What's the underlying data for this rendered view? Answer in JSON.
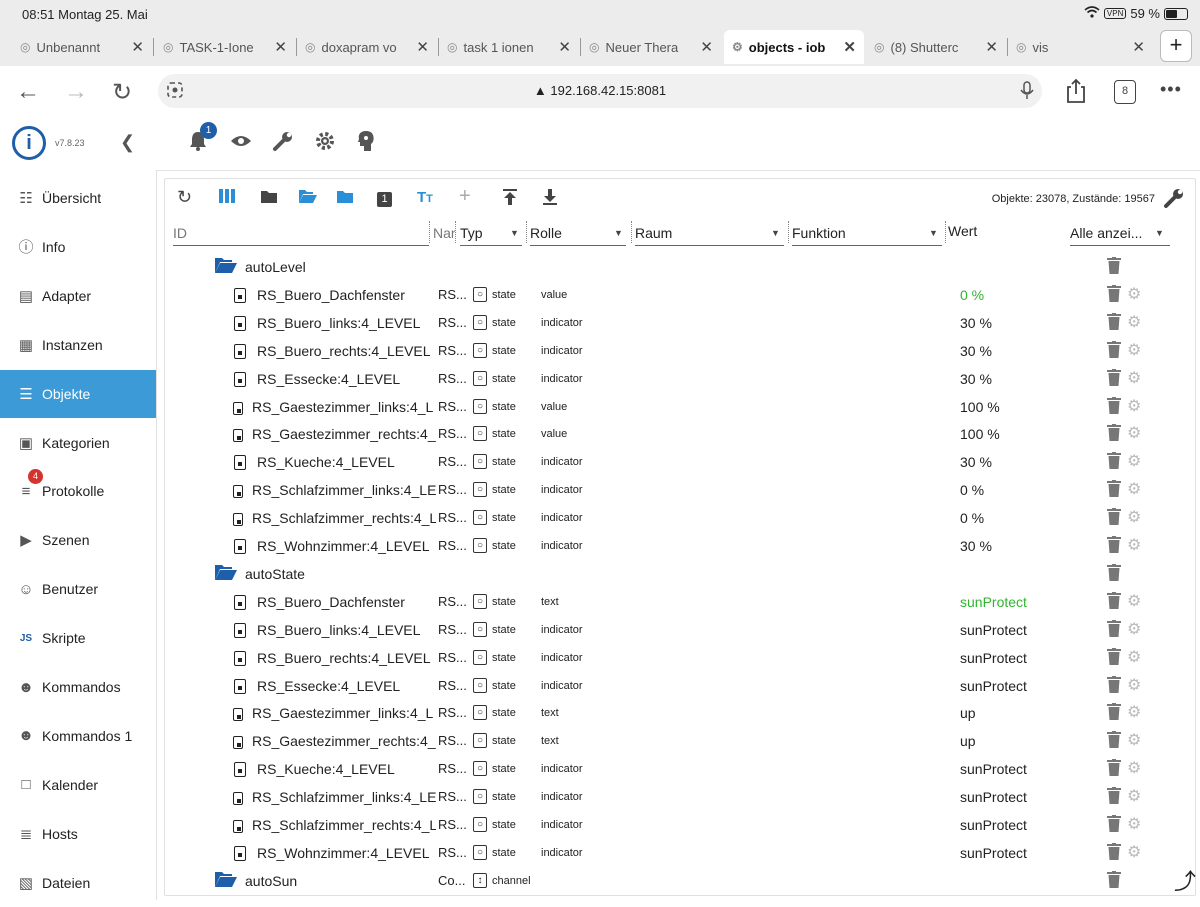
{
  "status_bar": {
    "time_date": "08:51   Montag 25. Mai",
    "vpn": "VPN",
    "battery_pct": "59 %",
    "battery_level": 0.59
  },
  "browser": {
    "tabs": [
      {
        "title": "Unbenannt",
        "active": false
      },
      {
        "title": "TASK-1-Ione",
        "active": false
      },
      {
        "title": "doxapram vo",
        "active": false
      },
      {
        "title": "task 1 ionen",
        "active": false
      },
      {
        "title": "Neuer Thera",
        "active": false
      },
      {
        "title": "objects - iob",
        "active": true
      },
      {
        "title": "(8) Shutterc",
        "active": false
      },
      {
        "title": "vis",
        "active": false
      }
    ],
    "url": "▲ 192.168.42.15:8081",
    "tab_count": "8"
  },
  "app": {
    "version": "v7.8.23",
    "notification_count": "1",
    "sidebar": [
      {
        "label": "Übersicht",
        "icon": "grid-icon"
      },
      {
        "label": "Info",
        "icon": "info-icon"
      },
      {
        "label": "Adapter",
        "icon": "store-icon"
      },
      {
        "label": "Instanzen",
        "icon": "instances-icon"
      },
      {
        "label": "Objekte",
        "icon": "list-icon",
        "active": true
      },
      {
        "label": "Kategorien",
        "icon": "categories-icon"
      },
      {
        "label": "Protokolle",
        "icon": "log-icon",
        "badge": "4"
      },
      {
        "label": "Szenen",
        "icon": "scenes-icon"
      },
      {
        "label": "Benutzer",
        "icon": "user-icon"
      },
      {
        "label": "Skripte",
        "icon": "js-icon"
      },
      {
        "label": "Kommandos",
        "icon": "commands-icon"
      },
      {
        "label": "Kommandos 1",
        "icon": "commands-icon"
      },
      {
        "label": "Kalender",
        "icon": "calendar-icon"
      },
      {
        "label": "Hosts",
        "icon": "hosts-icon"
      },
      {
        "label": "Dateien",
        "icon": "files-icon"
      }
    ]
  },
  "objects": {
    "counts_text": "Objekte: 23078, Zustände: 19567",
    "columns": {
      "id": "ID",
      "name": "Nar",
      "type": "Typ",
      "role": "Rolle",
      "room": "Raum",
      "function": "Funktion",
      "value": "Wert",
      "show_all": "Alle anzei..."
    },
    "rows": [
      {
        "kind": "folder",
        "name": "autoLevel"
      },
      {
        "kind": "state",
        "name": "RS_Buero_Dachfenster",
        "rname": "RS...",
        "typ": "state",
        "role": "value",
        "val": "0 %",
        "green": true
      },
      {
        "kind": "state",
        "name": "RS_Buero_links:4_LEVEL",
        "rname": "RS...",
        "typ": "state",
        "role": "indicator",
        "val": "30 %"
      },
      {
        "kind": "state",
        "name": "RS_Buero_rechts:4_LEVEL",
        "rname": "RS...",
        "typ": "state",
        "role": "indicator",
        "val": "30 %"
      },
      {
        "kind": "state",
        "name": "RS_Essecke:4_LEVEL",
        "rname": "RS...",
        "typ": "state",
        "role": "indicator",
        "val": "30 %"
      },
      {
        "kind": "state",
        "name": "RS_Gaestezimmer_links:4_L",
        "rname": "RS...",
        "typ": "state",
        "role": "value",
        "val": "100 %",
        "small": true
      },
      {
        "kind": "state",
        "name": "RS_Gaestezimmer_rechts:4_",
        "rname": "RS...",
        "typ": "state",
        "role": "value",
        "val": "100 %",
        "small": true
      },
      {
        "kind": "state",
        "name": "RS_Kueche:4_LEVEL",
        "rname": "RS...",
        "typ": "state",
        "role": "indicator",
        "val": "30 %"
      },
      {
        "kind": "state",
        "name": "RS_Schlafzimmer_links:4_LE",
        "rname": "RS...",
        "typ": "state",
        "role": "indicator",
        "val": "0 %",
        "small": true
      },
      {
        "kind": "state",
        "name": "RS_Schlafzimmer_rechts:4_L",
        "rname": "RS...",
        "typ": "state",
        "role": "indicator",
        "val": "0 %",
        "small": true
      },
      {
        "kind": "state",
        "name": "RS_Wohnzimmer:4_LEVEL",
        "rname": "RS...",
        "typ": "state",
        "role": "indicator",
        "val": "30 %"
      },
      {
        "kind": "folder",
        "name": "autoState"
      },
      {
        "kind": "state",
        "name": "RS_Buero_Dachfenster",
        "rname": "RS...",
        "typ": "state",
        "role": "text",
        "val": "sunProtect",
        "green": true
      },
      {
        "kind": "state",
        "name": "RS_Buero_links:4_LEVEL",
        "rname": "RS...",
        "typ": "state",
        "role": "indicator",
        "val": "sunProtect"
      },
      {
        "kind": "state",
        "name": "RS_Buero_rechts:4_LEVEL",
        "rname": "RS...",
        "typ": "state",
        "role": "indicator",
        "val": "sunProtect"
      },
      {
        "kind": "state",
        "name": "RS_Essecke:4_LEVEL",
        "rname": "RS...",
        "typ": "state",
        "role": "indicator",
        "val": "sunProtect"
      },
      {
        "kind": "state",
        "name": "RS_Gaestezimmer_links:4_L",
        "rname": "RS...",
        "typ": "state",
        "role": "text",
        "val": "up",
        "small": true
      },
      {
        "kind": "state",
        "name": "RS_Gaestezimmer_rechts:4_",
        "rname": "RS...",
        "typ": "state",
        "role": "text",
        "val": "up",
        "small": true
      },
      {
        "kind": "state",
        "name": "RS_Kueche:4_LEVEL",
        "rname": "RS...",
        "typ": "state",
        "role": "indicator",
        "val": "sunProtect"
      },
      {
        "kind": "state",
        "name": "RS_Schlafzimmer_links:4_LE",
        "rname": "RS...",
        "typ": "state",
        "role": "indicator",
        "val": "sunProtect",
        "small": true
      },
      {
        "kind": "state",
        "name": "RS_Schlafzimmer_rechts:4_L",
        "rname": "RS...",
        "typ": "state",
        "role": "indicator",
        "val": "sunProtect",
        "small": true
      },
      {
        "kind": "state",
        "name": "RS_Wohnzimmer:4_LEVEL",
        "rname": "RS...",
        "typ": "state",
        "role": "indicator",
        "val": "sunProtect"
      },
      {
        "kind": "channel",
        "name": "autoSun",
        "rname": "Co...",
        "typ": "channel"
      }
    ]
  }
}
